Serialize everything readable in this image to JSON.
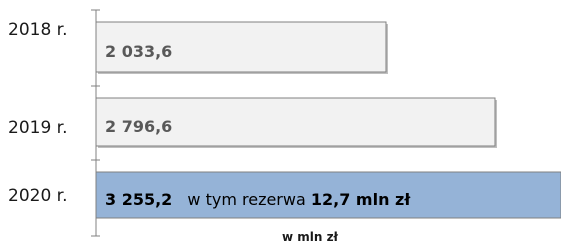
{
  "chart_data": {
    "type": "bar",
    "orientation": "horizontal",
    "categories": [
      "2018 r.",
      "2019 r.",
      "2020 r."
    ],
    "values": [
      2033.6,
      2796.6,
      3255.2
    ],
    "value_labels": [
      "2 033,6",
      "2 796,6",
      "3 255,2"
    ],
    "annotation": {
      "prefix": "w tym rezerwa",
      "value": "12,7 mln zł",
      "category": "2020 r."
    },
    "xlabel": "w mln zł",
    "colors": {
      "default_bar": "#f2f2f2",
      "highlight_bar": "#95b3d7",
      "bar_edge": "#808080"
    }
  }
}
